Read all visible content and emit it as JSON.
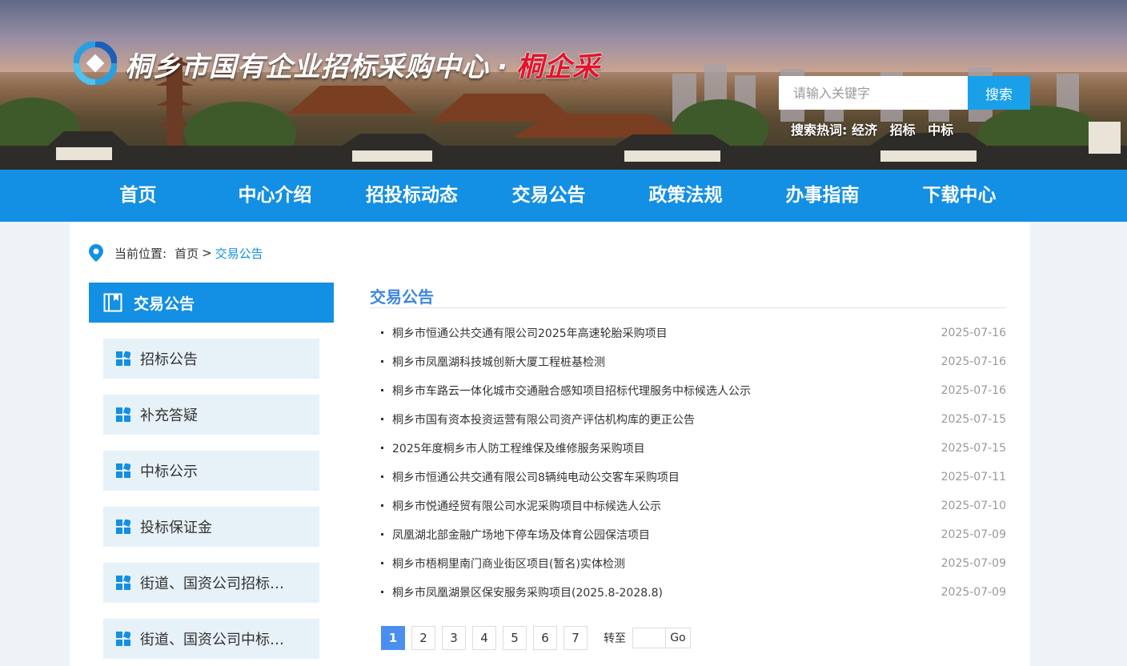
{
  "header": {
    "title_main": "桐乡市国有企业招标采购中心",
    "title_dot": "·",
    "title_brand": "桐企采",
    "search": {
      "placeholder": "请输入关键字",
      "button_label": "搜索"
    },
    "hotwords_label": "搜索热词:",
    "hotwords": [
      "经济",
      "招标",
      "中标"
    ]
  },
  "nav": {
    "items": [
      "首页",
      "中心介绍",
      "招投标动态",
      "交易公告",
      "政策法规",
      "办事指南",
      "下载中心"
    ]
  },
  "breadcrumb": {
    "label": "当前位置:",
    "home": "首页",
    "separator": ">",
    "current": "交易公告"
  },
  "sidebar": {
    "title": "交易公告",
    "items": [
      {
        "label": "招标公告"
      },
      {
        "label": "补充答疑"
      },
      {
        "label": "中标公示"
      },
      {
        "label": "投标保证金"
      },
      {
        "label": "街道、国资公司招标…"
      },
      {
        "label": "街道、国资公司中标…"
      }
    ]
  },
  "main": {
    "title": "交易公告",
    "list": [
      {
        "title": "桐乡市恒通公共交通有限公司2025年高速轮胎采购项目",
        "date": "2025-07-16"
      },
      {
        "title": "桐乡市凤凰湖科技城创新大厦工程桩基检测",
        "date": "2025-07-16"
      },
      {
        "title": "桐乡市车路云一体化城市交通融合感知项目招标代理服务中标候选人公示",
        "date": "2025-07-16"
      },
      {
        "title": "桐乡市国有资本投资运营有限公司资产评估机构库的更正公告",
        "date": "2025-07-15"
      },
      {
        "title": "2025年度桐乡市人防工程维保及维修服务采购项目",
        "date": "2025-07-15"
      },
      {
        "title": "桐乡市恒通公共交通有限公司8辆纯电动公交客车采购项目",
        "date": "2025-07-11"
      },
      {
        "title": "桐乡市悦通经贸有限公司水泥采购项目中标候选人公示",
        "date": "2025-07-10"
      },
      {
        "title": "凤凰湖北部金融广场地下停车场及体育公园保洁项目",
        "date": "2025-07-09"
      },
      {
        "title": "桐乡市梧桐里南门商业街区项目(暂名)实体检测",
        "date": "2025-07-09"
      },
      {
        "title": "桐乡市凤凰湖景区保安服务采购项目(2025.8-2028.8)",
        "date": "2025-07-09"
      }
    ]
  },
  "pagination": {
    "pages": [
      "1",
      "2",
      "3",
      "4",
      "5",
      "6",
      "7"
    ],
    "current": "1",
    "goto_label": "转至",
    "go_label": "Go"
  },
  "colors": {
    "primary": "#138fe3",
    "accent_title": "#3d86e0",
    "brand_red": "#e3132a",
    "sidebar_item_bg": "#e7f1f8"
  }
}
